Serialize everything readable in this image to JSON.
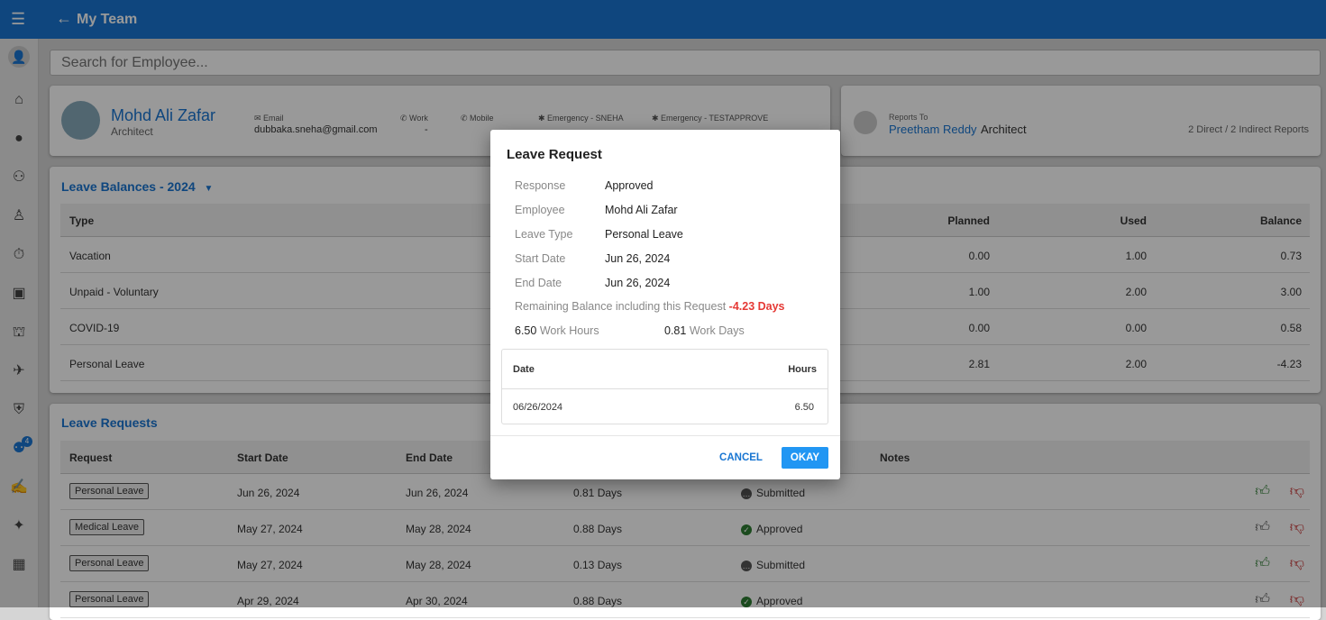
{
  "header": {
    "title": "My Team",
    "back_icon": "arrow-left-icon",
    "menu_icon": "hamburger-menu-icon"
  },
  "sidebar": {
    "items": [
      "home-icon",
      "account-circle-icon",
      "people-icon",
      "stamp-icon",
      "timer-icon",
      "calendar-check-icon",
      "bank-icon",
      "airplane-departure-icon",
      "shield-icon",
      "team-requests-icon",
      "hand-money-icon",
      "sparkle-icon",
      "dashboard-icon"
    ],
    "badge": "4"
  },
  "search": {
    "placeholder": "Search for Employee..."
  },
  "profile": {
    "name": "Mohd Ali Zafar",
    "title": "Architect",
    "email_label": "Email",
    "email": "dubbaka.sneha@gmail.com",
    "work_label": "Work",
    "work": "-",
    "mobile_label": "Mobile",
    "emergency1_label": "Emergency - SNEHA",
    "emergency2_label": "Emergency - TESTAPPROVE"
  },
  "reports": {
    "label": "Reports To",
    "name": "Preetham Reddy",
    "title": "Architect",
    "summary": "2 Direct / 2 Indirect Reports"
  },
  "balances": {
    "title": "Leave Balances - 2024",
    "columns": {
      "type": "Type",
      "planned": "Planned",
      "used": "Used",
      "balance": "Balance"
    },
    "rows": [
      {
        "type": "Vacation",
        "planned": "0.00",
        "used": "1.00",
        "balance": "0.73"
      },
      {
        "type": "Unpaid - Voluntary",
        "planned": "1.00",
        "used": "2.00",
        "balance": "3.00"
      },
      {
        "type": "COVID-19",
        "planned": "0.00",
        "used": "0.00",
        "balance": "0.58"
      },
      {
        "type": "Personal Leave",
        "planned": "2.81",
        "used": "2.00",
        "balance": "-4.23"
      }
    ]
  },
  "requests": {
    "title": "Leave Requests",
    "columns": {
      "request": "Request",
      "start": "Start Date",
      "end": "End Date",
      "notes": "Notes"
    },
    "rows": [
      {
        "request": "Personal Leave",
        "start": "Jun 26, 2024",
        "end": "Jun 26, 2024",
        "days": "0.81 Days",
        "status": "Submitted"
      },
      {
        "request": "Medical Leave",
        "start": "May 27, 2024",
        "end": "May 28, 2024",
        "days": "0.88 Days",
        "status": "Approved"
      },
      {
        "request": "Personal Leave",
        "start": "May 27, 2024",
        "end": "May 28, 2024",
        "days": "0.13 Days",
        "status": "Submitted"
      },
      {
        "request": "Personal Leave",
        "start": "Apr 29, 2024",
        "end": "Apr 30, 2024",
        "days": "0.88 Days",
        "status": "Approved"
      }
    ]
  },
  "modal": {
    "title": "Leave Request",
    "fields": [
      {
        "label": "Response",
        "value": "Approved"
      },
      {
        "label": "Employee",
        "value": "Mohd Ali Zafar"
      },
      {
        "label": "Leave Type",
        "value": "Personal Leave"
      },
      {
        "label": "Start Date",
        "value": "Jun 26, 2024"
      },
      {
        "label": "End Date",
        "value": "Jun 26, 2024"
      }
    ],
    "remaining_label": "Remaining Balance including this Request",
    "remaining_value": "-4.23 Days",
    "hours": "6.50",
    "hours_label": "Work Hours",
    "days": "0.81",
    "days_label": "Work Days",
    "table": {
      "date_header": "Date",
      "hours_header": "Hours",
      "rows": [
        {
          "date": "06/26/2024",
          "hours": "6.50"
        }
      ]
    },
    "cancel": "CANCEL",
    "okay": "OKAY"
  },
  "colors": {
    "primary": "#1976d2",
    "negative": "#e53935",
    "approve": "#2e7d32",
    "reject": "#c62828"
  }
}
